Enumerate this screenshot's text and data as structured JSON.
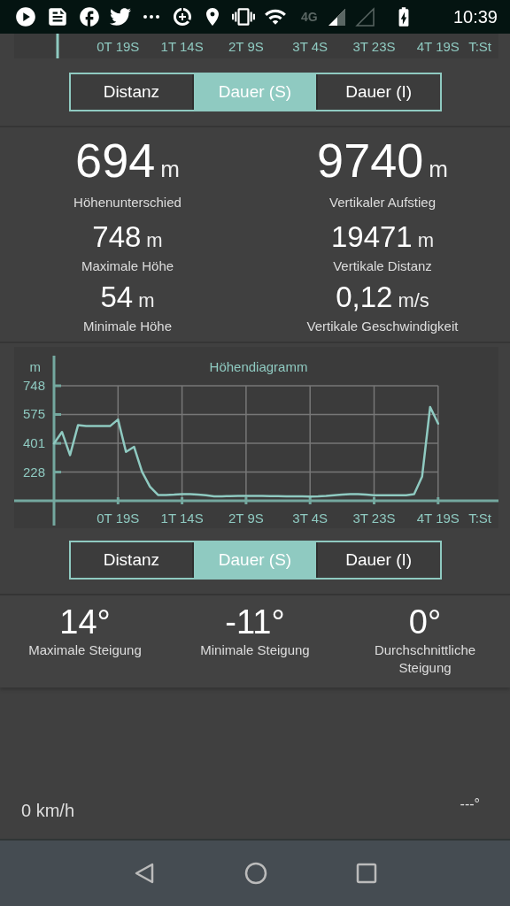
{
  "status_bar": {
    "network": "4G",
    "time": "10:39"
  },
  "top_chart_fragment": {
    "xtick_labels": [
      "0T 19S",
      "1T 14S",
      "2T 9S",
      "3T 4S",
      "3T 23S",
      "4T 19S"
    ],
    "xlabel": "T:St"
  },
  "tabs_top": [
    {
      "label": "Distanz",
      "selected": false
    },
    {
      "label": "Dauer (S)",
      "selected": true
    },
    {
      "label": "Dauer (I)",
      "selected": false
    }
  ],
  "stats": [
    {
      "kind": "primary",
      "value": "694",
      "unit": "m",
      "label": "Höhenunterschied"
    },
    {
      "kind": "primary",
      "value": "9740",
      "unit": "m",
      "label": "Vertikaler Aufstieg"
    },
    {
      "kind": "secondary",
      "value": "748",
      "unit": "m",
      "label": "Maximale Höhe"
    },
    {
      "kind": "secondary",
      "value": "19471",
      "unit": "m",
      "label": "Vertikale Distanz"
    },
    {
      "kind": "secondary",
      "value": "54",
      "unit": "m",
      "label": "Minimale Höhe"
    },
    {
      "kind": "secondary",
      "value": "0,12",
      "unit": "m/s",
      "label": "Vertikale Geschwindigkeit"
    }
  ],
  "elevation_chart": {
    "chart_data": {
      "type": "line",
      "grid": true,
      "title": "Höhendiagramm",
      "xlabel": "T:St",
      "ylabel": "m",
      "ylim": [
        55,
        748
      ],
      "yticks": [
        228,
        401,
        575,
        748
      ],
      "categories": [
        null,
        null,
        null,
        null,
        null,
        null,
        null,
        null,
        "0T 19S",
        null,
        null,
        null,
        null,
        null,
        null,
        null,
        "1T 14S",
        null,
        null,
        null,
        null,
        null,
        null,
        null,
        "2T 9S",
        null,
        null,
        null,
        null,
        null,
        null,
        null,
        "3T 4S",
        null,
        null,
        null,
        null,
        null,
        null,
        null,
        "3T 23S",
        null,
        null,
        null,
        null,
        null,
        null,
        null,
        "4T 19S"
      ],
      "series": [
        {
          "color": "#8fcac1",
          "values": [
            400,
            470,
            330,
            510,
            505,
            505,
            505,
            505,
            545,
            350,
            380,
            230,
            140,
            90,
            90,
            92,
            95,
            95,
            92,
            88,
            82,
            82,
            83,
            84,
            85,
            85,
            84,
            83,
            83,
            82,
            82,
            81,
            80,
            81,
            84,
            88,
            93,
            95,
            95,
            92,
            88,
            88,
            88,
            88,
            88,
            95,
            200,
            620,
            520
          ]
        }
      ]
    }
  },
  "tabs_bottom": [
    {
      "label": "Distanz",
      "selected": false
    },
    {
      "label": "Dauer (S)",
      "selected": true
    },
    {
      "label": "Dauer (I)",
      "selected": false
    }
  ],
  "slopes": [
    {
      "value": "14°",
      "label": "Maximale Steigung"
    },
    {
      "value": "-11°",
      "label": "Minimale Steigung"
    },
    {
      "value": "0°",
      "label": "Durchschnittliche Steigung"
    }
  ],
  "footer": {
    "speed": "0 km/h",
    "heading": "---°"
  }
}
